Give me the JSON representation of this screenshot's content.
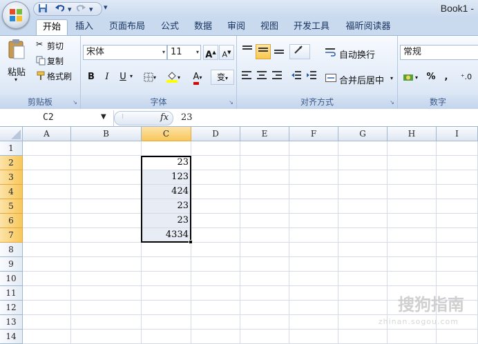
{
  "window": {
    "title": "Book1 -"
  },
  "quick_access": {
    "save_icon": "save-icon",
    "undo_icon": "undo-icon",
    "redo_icon": "redo-icon",
    "customize_glyph": "▾"
  },
  "tabs": [
    "开始",
    "插入",
    "页面布局",
    "公式",
    "数据",
    "审阅",
    "视图",
    "开发工具",
    "福昕阅读器"
  ],
  "active_tab": "开始",
  "clipboard": {
    "paste_label": "粘贴",
    "cut_label": "剪切",
    "copy_label": "复制",
    "format_painter_label": "格式刷",
    "group_label": "剪贴板"
  },
  "font": {
    "name": "宋体",
    "size": "11",
    "grow_label": "A",
    "shrink_label": "A",
    "bold": "B",
    "italic": "I",
    "underline": "U",
    "font_color_label": "A",
    "phonetic_label": "变",
    "group_label": "字体"
  },
  "alignment": {
    "wrap_text_label": "自动换行",
    "merge_center_label": "合并后居中",
    "group_label": "对齐方式"
  },
  "number": {
    "format": "常规",
    "percent_label": "%",
    "comma_label": ",",
    "decimal_label": "⁺.0",
    "group_label": "数字"
  },
  "formula_bar": {
    "name_box": "C2",
    "fx_label": "fx",
    "value": "23"
  },
  "sheet": {
    "columns": [
      "A",
      "B",
      "C",
      "D",
      "E",
      "F",
      "G",
      "H",
      "I"
    ],
    "rows": [
      "1",
      "2",
      "3",
      "4",
      "5",
      "6",
      "7",
      "8",
      "9",
      "10",
      "11",
      "12",
      "13",
      "14"
    ],
    "selected_column": "C",
    "selected_rows": [
      "2",
      "3",
      "4",
      "5",
      "6",
      "7"
    ],
    "column_c_values": [
      "",
      "23",
      "123",
      "424",
      "23",
      "23",
      "4334"
    ]
  },
  "watermark": {
    "text": "搜狗指南",
    "url": "zhinan.sogou.com"
  },
  "colors": {
    "accent": "#f8c75a",
    "ribbon_bg": "#dbe6f4",
    "tab_text": "#15325e",
    "font_color_bar": "#e00000",
    "highlight_bar": "#ffff00"
  }
}
